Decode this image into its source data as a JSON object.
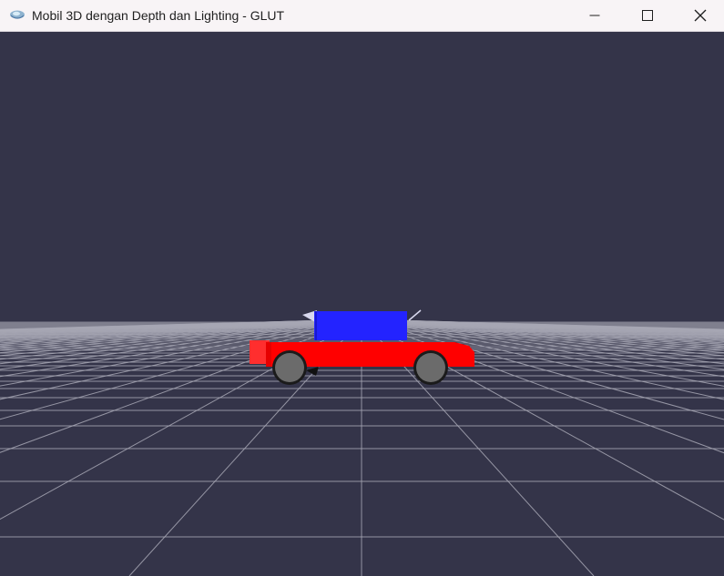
{
  "window": {
    "title": "Mobil 3D dengan Depth dan Lighting - GLUT",
    "icon": "glut-app-icon",
    "controls": {
      "minimize_icon": "minimize-icon",
      "maximize_icon": "maximize-icon",
      "close_icon": "close-icon"
    }
  },
  "scene": {
    "background_color": "#343449",
    "grid_color": "#a7a7b4",
    "car": {
      "body_color": "#ff0000",
      "cabin_color": "#2323ff",
      "wheel_color": "#6b6b6b",
      "tire_color": "#1b1b1b",
      "windshield_color": "#d8d8ee"
    }
  }
}
